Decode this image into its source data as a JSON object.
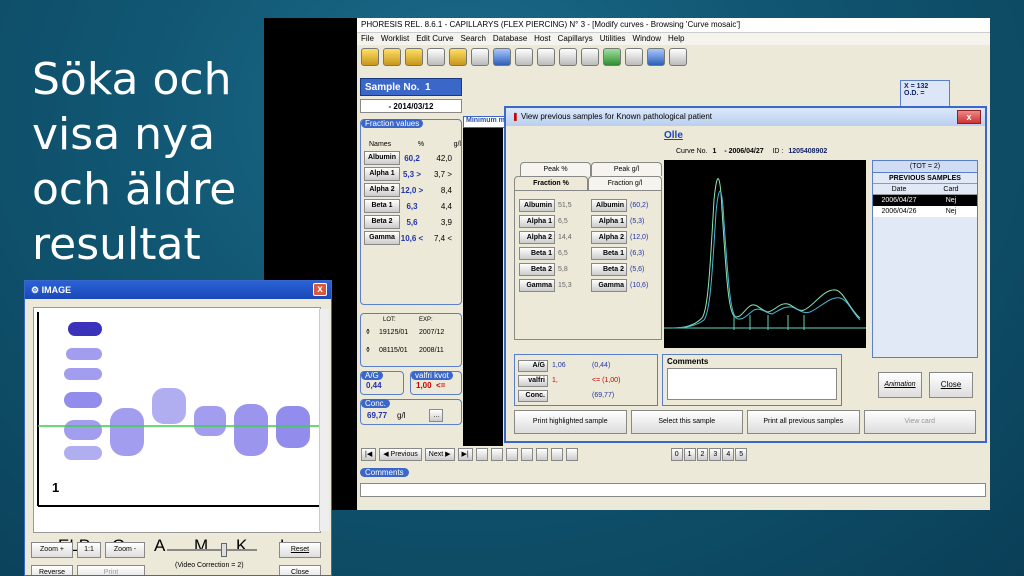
{
  "slide": {
    "title": "Söka och visa nya och äldre resultat"
  },
  "main_window": {
    "title": "PHORESIS REL. 8.6.1 - CAPILLARYS (FLEX PIERCING) N° 3 - [Modify curves - Browsing 'Curve mosaic']",
    "menu": [
      "File",
      "Worklist",
      "Edit Curve",
      "Search",
      "Database",
      "Host",
      "Capillarys",
      "Utilities",
      "Window",
      "Help"
    ],
    "sample_label": "Sample No.",
    "sample_no": "1",
    "date": "- 2014/03/12",
    "fraction_values_label": "Fraction values",
    "col_names": "Names",
    "col_pct": "%",
    "col_gl": "g/l",
    "fractions": [
      {
        "name": "Albumin",
        "pct": "60,2",
        "gl": "42,0"
      },
      {
        "name": "Alpha 1",
        "pct": "5,3 >",
        "gl": "3,7 >"
      },
      {
        "name": "Alpha 2",
        "pct": "12,0 >",
        "gl": "8,4"
      },
      {
        "name": "Beta 1",
        "pct": "6,3",
        "gl": "4,4"
      },
      {
        "name": "Beta 2",
        "pct": "5,6",
        "gl": "3,9"
      },
      {
        "name": "Gamma",
        "pct": "10,6 <",
        "gl": "7,4 <"
      }
    ],
    "minimum_label": "Minimum m",
    "lot_label": "LOT:",
    "exp_label": "EXP:",
    "lots": [
      {
        "lot": "19125/01",
        "exp": "2007/12"
      },
      {
        "lot": "08115/01",
        "exp": "2008/11"
      }
    ],
    "ag_label": "A/G",
    "ag_value": "0,44",
    "valfri_label": "valfri kvot",
    "valfri_value": "1,00",
    "valfri_flag": "<=",
    "conc_label": "Conc.",
    "conc_value": "69,77",
    "conc_unit": "g/l",
    "conc_btn": "...",
    "xod": {
      "x": "X = 132",
      "od": "O.D. ="
    },
    "nav": {
      "previous": "Previous",
      "next": "Next"
    },
    "pages": [
      "0",
      "1",
      "2",
      "3",
      "4",
      "5"
    ],
    "comments_label": "Comments"
  },
  "dialog": {
    "title": "View previous samples for Known pathological patient",
    "close": "x",
    "patient": "Olle",
    "curve_label": "Curve No.",
    "curve_no": "1",
    "curve_date": "- 2006/04/27",
    "id_label": "ID :",
    "id_value": "1205408902",
    "tabs_top": [
      "Peak %",
      "Peak g/l"
    ],
    "tabs_bottom": [
      "Fraction %",
      "Fraction g/l"
    ],
    "rows": [
      {
        "name": "Albumin",
        "v1": "51,5",
        "v2": "(60,2)"
      },
      {
        "name": "Alpha 1",
        "v1": "6,5",
        "v2": "(5,3)"
      },
      {
        "name": "Alpha 2",
        "v1": "14,4",
        "v2": "(12,0)"
      },
      {
        "name": "Beta 1",
        "v1": "6,5",
        "v2": "(6,3)"
      },
      {
        "name": "Beta 2",
        "v1": "5,8",
        "v2": "(5,6)"
      },
      {
        "name": "Gamma",
        "v1": "15,3",
        "v2": "(10,6)"
      }
    ],
    "prev": {
      "tot": "(TOT = 2)",
      "header": "PREVIOUS SAMPLES",
      "col_date": "Date",
      "col_card": "Card",
      "rows": [
        {
          "date": "2006/04/27",
          "card": "Nej"
        },
        {
          "date": "2006/04/26",
          "card": "Nej"
        }
      ]
    },
    "ag": {
      "label": "A/G",
      "v1": "1,06",
      "v2": "(0,44)"
    },
    "valfri": {
      "label": "valfri",
      "v1": "1,",
      "v2": "<= (1,00)"
    },
    "conc": {
      "label": "Conc.",
      "v2": "(69,77)"
    },
    "comments_label": "Comments",
    "animation": "Animation",
    "close_btn": "Close",
    "buttons": [
      "Print highlighted sample",
      "Select this sample",
      "Print all previous samples",
      "View card"
    ]
  },
  "image_window": {
    "title": "IMAGE",
    "close": "x",
    "corner_label": "1",
    "lanes": [
      "ELP",
      "G",
      "A",
      "M",
      "K",
      "L"
    ],
    "zoom_plus": "Zoom +",
    "ratio": "1:1",
    "zoom_minus": "Zoom -",
    "reset": "Reset",
    "reverse": "Reverse",
    "print": "Print",
    "video_correction": "(Video Correction = 2)",
    "close_btn": "Close"
  }
}
